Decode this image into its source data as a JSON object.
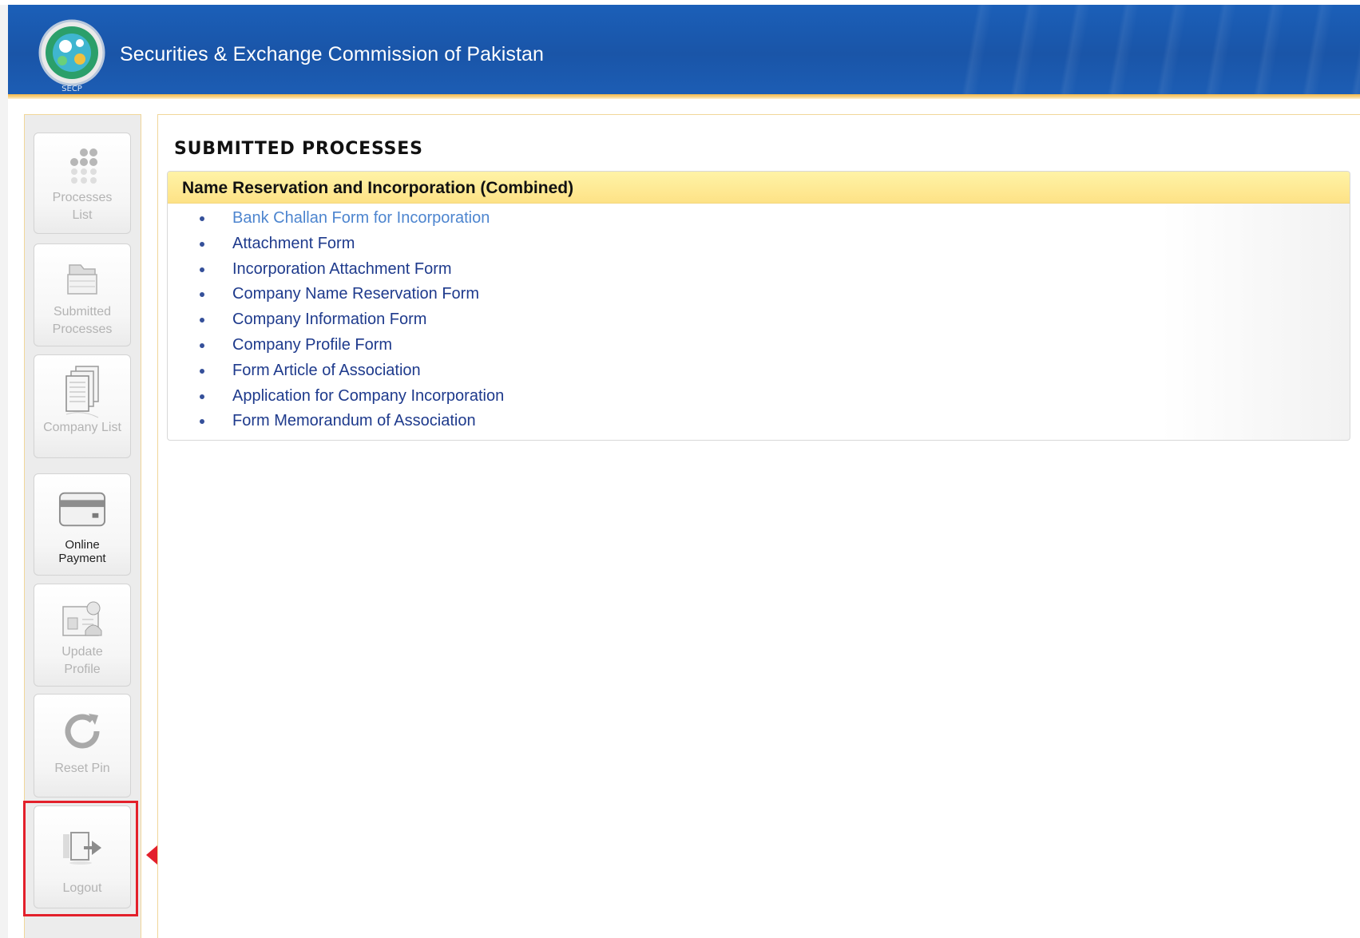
{
  "header": {
    "title": "Securities & Exchange Commission of Pakistan",
    "logo_text": "SECP"
  },
  "sidebar": {
    "items": [
      {
        "label": "Processes\nList",
        "icon": "dots-grid-icon"
      },
      {
        "label": "Submitted\nProcesses",
        "icon": "folder-icon"
      },
      {
        "label": "Company List",
        "icon": "documents-stack-icon"
      },
      {
        "label": "Online\nPayment",
        "icon": "credit-card-icon"
      },
      {
        "label": "Update\nProfile",
        "icon": "profile-card-icon"
      },
      {
        "label": "Reset Pin",
        "icon": "refresh-icon"
      },
      {
        "label": "Logout",
        "icon": "logout-door-icon"
      }
    ]
  },
  "main": {
    "title": "SUBMITTED PROCESSES",
    "section": {
      "heading": "Name Reservation and Incorporation (Combined)",
      "links": [
        "Bank Challan Form for Incorporation",
        "Attachment Form",
        "Incorporation Attachment Form",
        "Company Name Reservation Form",
        "Company Information Form",
        "Company Profile Form",
        "Form Article of Association",
        "Application for Company Incorporation",
        "Form Memorandum of Association"
      ]
    }
  },
  "colors": {
    "header_blue": "#1b5fb8",
    "accent_orange": "#f6b94a",
    "section_yellow": "#fde286",
    "link_blue": "#1e3a8c",
    "highlight_red": "#e3202b"
  }
}
